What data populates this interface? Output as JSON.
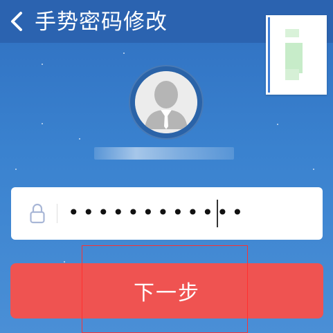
{
  "header": {
    "back_icon": "chevron-left-icon",
    "title": "手势密码修改"
  },
  "profile": {
    "avatar_icon": "user-avatar-icon",
    "username": ""
  },
  "password": {
    "lock_icon": "lock-icon",
    "value": "••••••••••••"
  },
  "actions": {
    "next_label": "下一步"
  },
  "colors": {
    "header_bg": "#2b63b0",
    "button_bg": "#ef5351",
    "annotation": "#ff3030"
  }
}
